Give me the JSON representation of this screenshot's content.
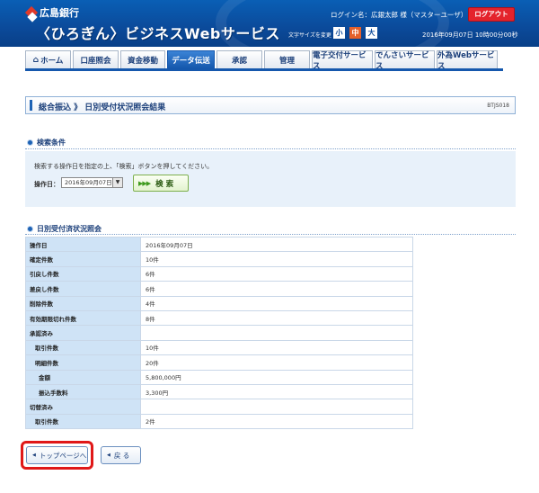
{
  "header": {
    "bank_name": "広島銀行",
    "service_name": "〈ひろぎん〉ビジネスWebサービス",
    "login_info": "ログイン名：広銀太郎 様（マスターユーザ）",
    "logout_label": "ログアウト",
    "font_size_label": "文字サイズを変更",
    "font_sizes": [
      "小",
      "中",
      "大"
    ],
    "datetime": "2016年09月07日 10時00分00秒"
  },
  "nav": {
    "tabs": [
      {
        "label": "ホーム",
        "active": false
      },
      {
        "label": "口座照会",
        "active": false
      },
      {
        "label": "資金移動",
        "active": false
      },
      {
        "label": "データ伝送",
        "active": true
      },
      {
        "label": "承認",
        "active": false
      },
      {
        "label": "管理",
        "active": false
      },
      {
        "label": "電子交付サービス",
        "active": false
      },
      {
        "label": "でんさいサービス",
        "active": false
      },
      {
        "label": "外為Webサービス",
        "active": false
      }
    ]
  },
  "page": {
    "title": "総合振込 》 日別受付状況照会結果",
    "screen_id": "BTJS018"
  },
  "search": {
    "section_title": "検索条件",
    "description": "検索する操作日を指定の上、「検索」ボタンを押してください。",
    "date_label": "操作日：",
    "date_value": "2016年09月07日",
    "search_button": "検 索"
  },
  "results": {
    "section_title": "日別受付済状況照会",
    "rows": [
      {
        "label": "操作日",
        "value": "2016年09月07日"
      },
      {
        "label": "確定件数",
        "value": "10件"
      },
      {
        "label": "引戻し件数",
        "value": "6件"
      },
      {
        "label": "差戻し件数",
        "value": "6件"
      },
      {
        "label": "削除件数",
        "value": "4件"
      },
      {
        "label": "有効期限切れ件数",
        "value": "8件"
      },
      {
        "label": "承認済み",
        "value": ""
      },
      {
        "label": "取引件数",
        "value": "10件"
      },
      {
        "label": "明細件数",
        "value": "20件"
      },
      {
        "label": "金額",
        "value": "5,800,000円"
      },
      {
        "label": "振込手数料",
        "value": "3,300円"
      },
      {
        "label": "切替済み",
        "value": ""
      },
      {
        "label": "取引件数",
        "value": "2件"
      }
    ]
  },
  "footer": {
    "top_page_button": "トップページへ",
    "back_button": "戻 る"
  }
}
